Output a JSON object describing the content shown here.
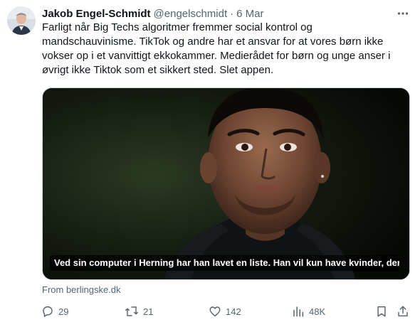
{
  "author": {
    "name": "Jakob Engel-Schmidt",
    "handle": "@engelschmidt",
    "separator": "·",
    "time": "6 Mar"
  },
  "tweet": {
    "text": "Farligt når Big Techs algoritmer fremmer social kontrol og\nmandschauvinisme. TikTok og andre har et ansvar for at vores børn ikke\nvokser op i et vanvittigt ekkokammer. Medierådet for børn og unge anser i\nøvrigt ikke Tiktok som et sikkert sted. Slet appen."
  },
  "card": {
    "caption": "Ved sin computer i Herning har han lavet en liste. Han vil kun have kvinder, der v...",
    "source": "From berlingske.dk"
  },
  "actions": {
    "replies": "29",
    "reposts": "21",
    "likes": "142",
    "views": "48K"
  },
  "icons": {
    "more": "more-horizontal-icon",
    "reply": "reply-icon",
    "repost": "repost-icon",
    "like": "heart-icon",
    "views": "views-icon",
    "bookmark": "bookmark-icon",
    "share": "share-icon"
  },
  "colors": {
    "text": "#0f1419",
    "secondary": "#536471",
    "border": "#cfd9de"
  }
}
